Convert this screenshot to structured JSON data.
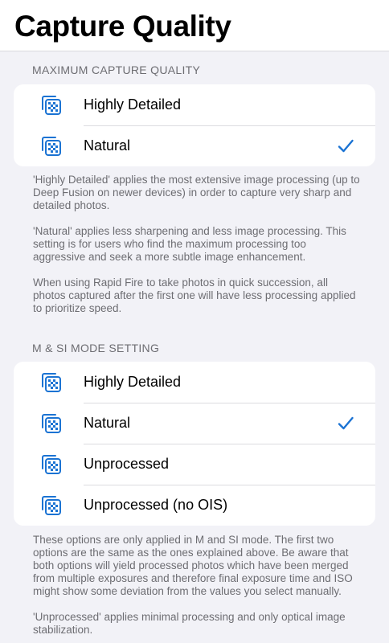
{
  "page_title": "Capture Quality",
  "accent_color": "#1b73d3",
  "sections": [
    {
      "header": "MAXIMUM CAPTURE QUALITY",
      "options": [
        {
          "label": "Highly Detailed",
          "icon": "photo-stack-icon",
          "selected": false
        },
        {
          "label": "Natural",
          "icon": "photo-stack-icon",
          "selected": true
        }
      ],
      "footer": [
        "'Highly Detailed' applies the most extensive image processing (up to Deep Fusion on newer devices) in order to capture very sharp and detailed photos.",
        "'Natural' applies less sharpening and less image processing. This setting is for users who find the maximum processing too aggressive and seek a more subtle image enhancement.",
        "When using Rapid Fire to take photos in quick succession, all photos captured after the first one will have less processing applied to prioritize speed."
      ]
    },
    {
      "header": "M & SI MODE SETTING",
      "options": [
        {
          "label": "Highly Detailed",
          "icon": "photo-stack-icon",
          "selected": false
        },
        {
          "label": "Natural",
          "icon": "photo-stack-icon",
          "selected": true
        },
        {
          "label": "Unprocessed",
          "icon": "photo-stack-icon",
          "selected": false
        },
        {
          "label": "Unprocessed (no OIS)",
          "icon": "photo-stack-icon",
          "selected": false
        }
      ],
      "footer": [
        "These options are only applied in M and SI mode. The first two options are the same as the ones explained above. Be aware that both options will yield processed photos which have been merged from multiple exposures and therefore final exposure time and ISO might show some deviation from the values you select manually.",
        "'Unprocessed' applies minimal processing and only optical image stabilization."
      ]
    }
  ]
}
